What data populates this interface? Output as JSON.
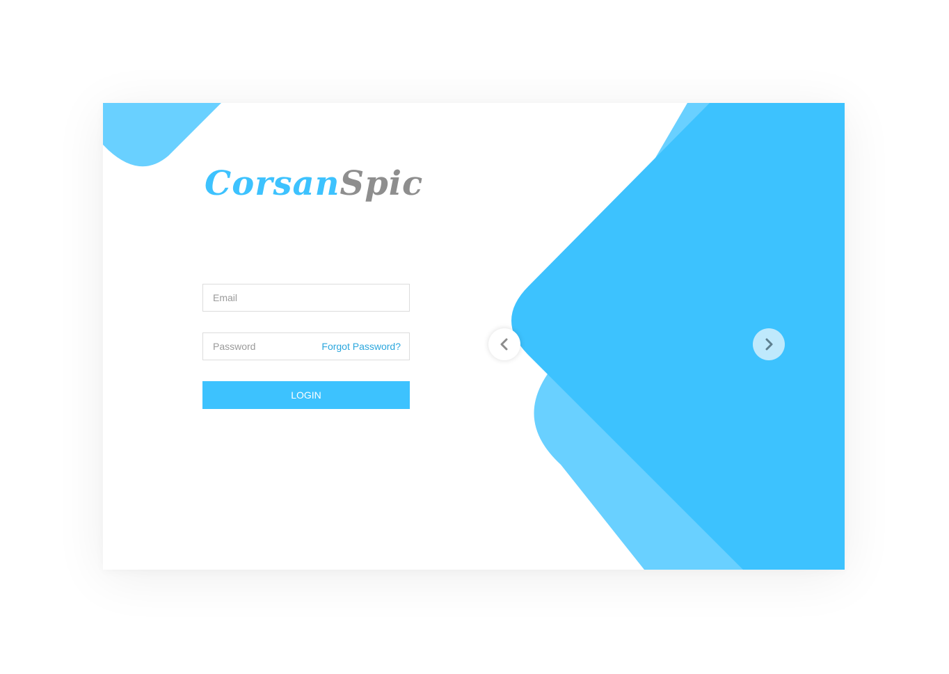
{
  "brand": {
    "name_part1": "Corsan",
    "name_part2": "Spic",
    "primary_color": "#3dc2fe",
    "secondary_color": "#8e8e8e",
    "light_accent": "#69d0ff"
  },
  "login_form": {
    "email_placeholder": "Email",
    "password_placeholder": "Password",
    "forgot_password_label": "Forgot Password?",
    "login_button_label": "LOGIN"
  },
  "carousel": {
    "prev_icon": "chevron-left-icon",
    "next_icon": "chevron-right-icon"
  }
}
